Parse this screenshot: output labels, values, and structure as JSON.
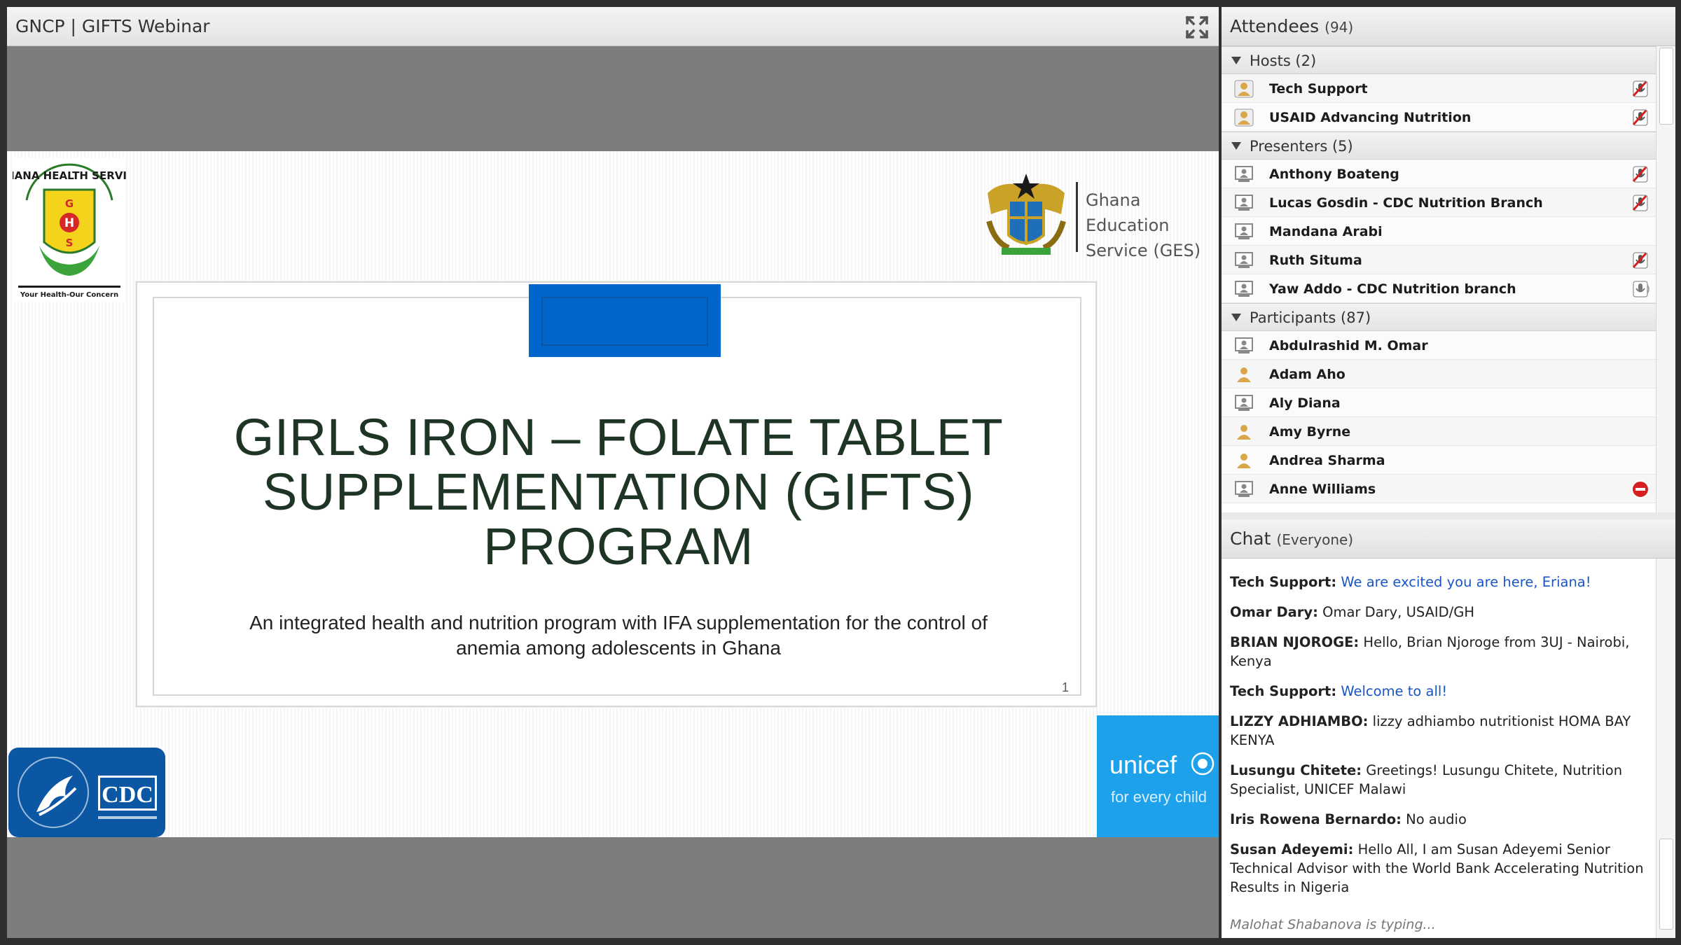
{
  "stage": {
    "title": "GNCP | GIFTS Webinar",
    "fullscreen_icon": "expand-icon"
  },
  "slide": {
    "ghs_logo_icon": "ghana-health-service-logo",
    "ges_logo_icon": "ghana-coat-of-arms-logo",
    "ges_text_line1": "Ghana Education",
    "ges_text_line2": "Service (GES)",
    "title_line1": "GIRLS IRON – FOLATE TABLET",
    "title_line2": "SUPPLEMENTATION (GIFTS)",
    "title_line3": "PROGRAM",
    "subtitle_line1": "An integrated health and nutrition program with IFA supplementation for the control of",
    "subtitle_line2": "anemia among adolescents in Ghana",
    "page_number": "1",
    "cdc_logo_icon": "cdc-hhs-logo",
    "unicef_name": "unicef",
    "unicef_tagline": "for every child",
    "colors": {
      "blue_box": "#0066cc",
      "unicef_blue": "#1ca1ea",
      "cdc_blue": "#0b57a4"
    }
  },
  "attendees": {
    "title": "Attendees",
    "count": "(94)",
    "groups": {
      "hosts": {
        "label": "Hosts (2)"
      },
      "presenters": {
        "label": "Presenters (5)"
      },
      "participants": {
        "label": "Participants (87)"
      }
    },
    "hosts": [
      {
        "name": "Tech Support",
        "status": "mic-pencil-icon"
      },
      {
        "name": "USAID Advancing Nutrition",
        "status": "mic-pencil-icon"
      }
    ],
    "presenters": [
      {
        "name": "Anthony Boateng",
        "status": "mic-pencil-icon"
      },
      {
        "name": "Lucas Gosdin - CDC Nutrition Branch",
        "status": "mic-pencil-icon"
      },
      {
        "name": "Mandana Arabi",
        "status": ""
      },
      {
        "name": "Ruth Situma",
        "status": "mic-pencil-icon"
      },
      {
        "name": "Yaw Addo - CDC Nutrition branch",
        "status": "microphone-icon"
      }
    ],
    "participants": [
      {
        "name": "Abdulrashid M. Omar",
        "status": ""
      },
      {
        "name": "Adam Aho",
        "status": ""
      },
      {
        "name": "Aly Diana",
        "status": ""
      },
      {
        "name": "Amy Byrne",
        "status": ""
      },
      {
        "name": "Andrea Sharma",
        "status": ""
      },
      {
        "name": "Anne Williams",
        "status": "do-not-enter-icon"
      }
    ]
  },
  "chat": {
    "title": "Chat",
    "scope": "(Everyone)",
    "messages": [
      {
        "who": "Tech Support:",
        "text": "We are excited you are here, Eriana!",
        "blue": true
      },
      {
        "who": "Omar Dary:",
        "text": "Omar Dary, USAID/GH",
        "blue": false
      },
      {
        "who": "BRIAN NJOROGE:",
        "text": "Hello, Brian Njoroge from 3UJ - Nairobi, Kenya",
        "blue": false
      },
      {
        "who": "Tech Support:",
        "text": "Welcome to all!",
        "blue": true
      },
      {
        "who": "LIZZY ADHIAMBO:",
        "text": "lizzy adhiambo nutritionist HOMA BAY KENYA",
        "blue": false
      },
      {
        "who": "Lusungu Chitete:",
        "text": "Greetings! Lusungu Chitete, Nutrition Specialist, UNICEF Malawi",
        "blue": false
      },
      {
        "who": "Iris Rowena Bernardo:",
        "text": "No audio",
        "blue": false
      },
      {
        "who": "Susan Adeyemi:",
        "text": "Hello All, I am Susan Adeyemi Senior Technical Advisor with the World Bank Accelerating Nutrition Results in Nigeria",
        "blue": false
      }
    ],
    "typing": "Malohat Shabanova is typing..."
  }
}
